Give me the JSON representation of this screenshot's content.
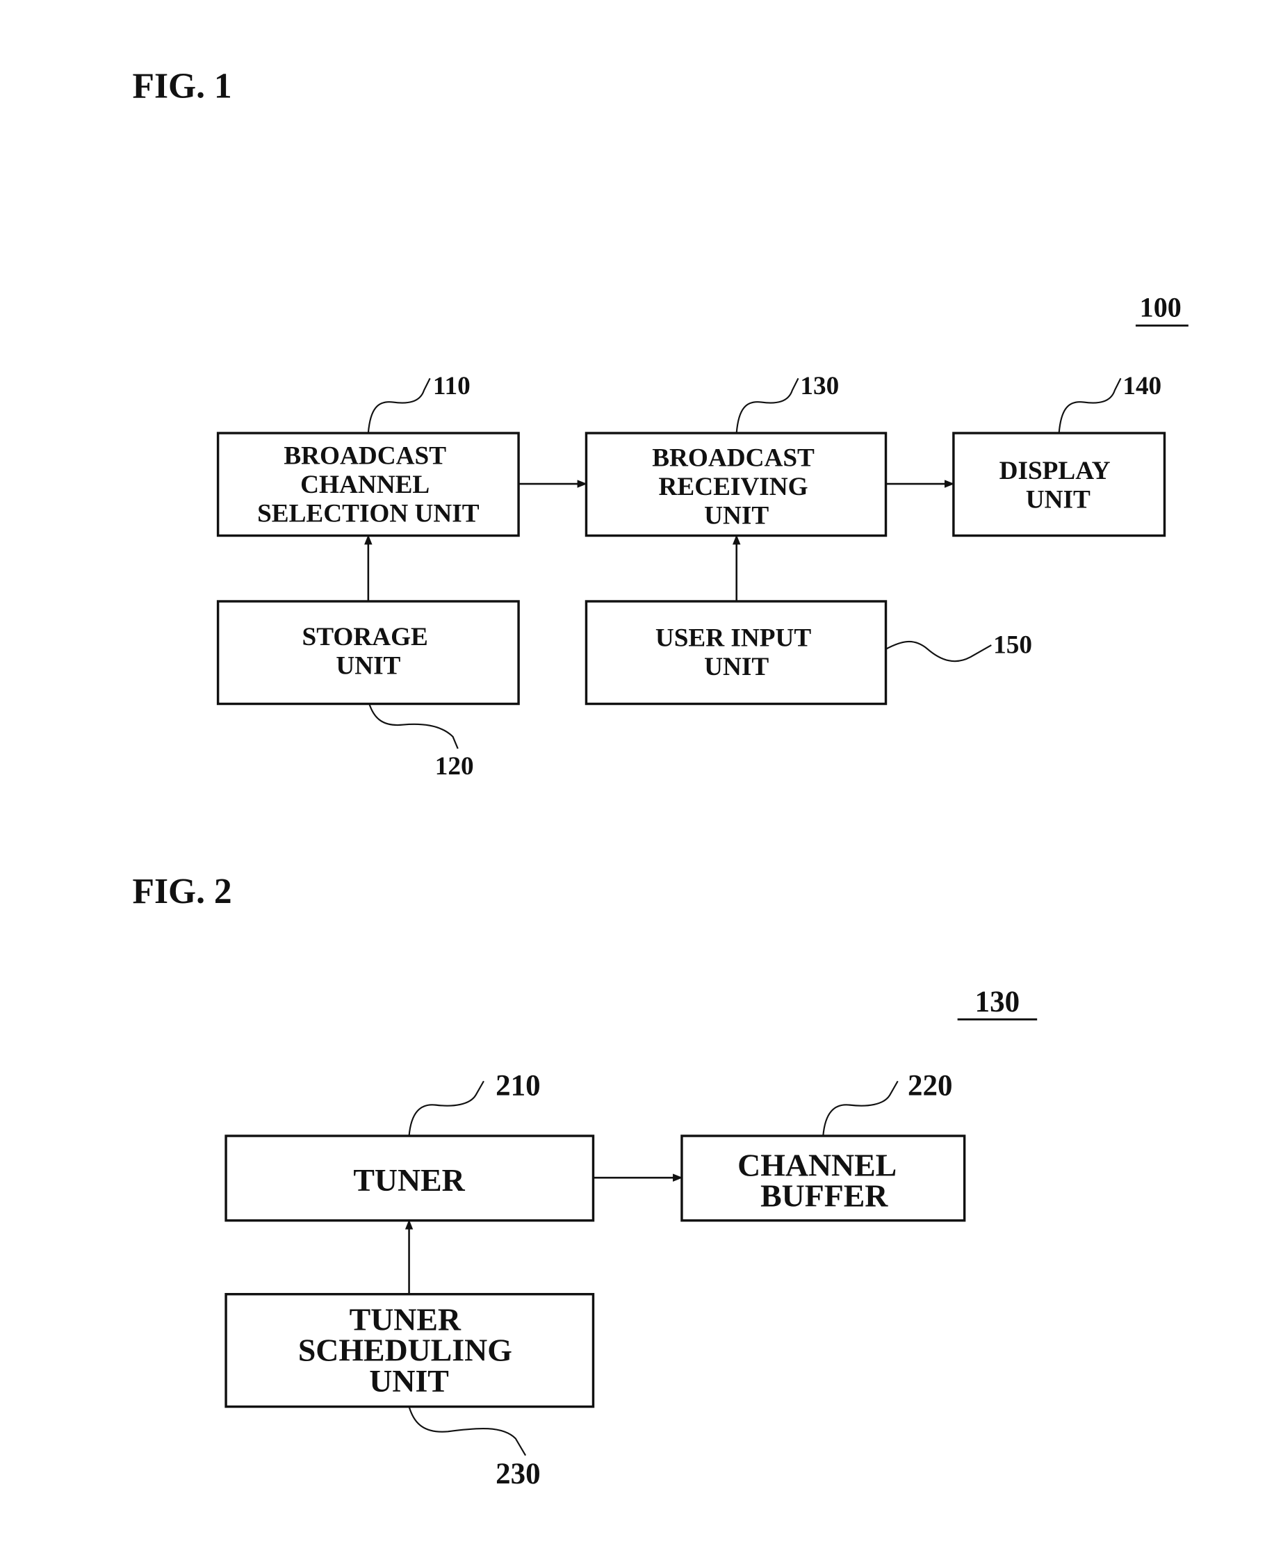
{
  "figures": [
    {
      "title": "FIG. 1",
      "system_ref": "100",
      "blocks": [
        {
          "id": "110",
          "lines": [
            "BROADCAST",
            "CHANNEL",
            "SELECTION UNIT"
          ]
        },
        {
          "id": "130",
          "lines": [
            "BROADCAST",
            "RECEIVING",
            "UNIT"
          ]
        },
        {
          "id": "140",
          "lines": [
            "DISPLAY",
            "UNIT"
          ]
        },
        {
          "id": "120",
          "lines": [
            "STORAGE",
            "UNIT"
          ]
        },
        {
          "id": "150",
          "lines": [
            "USER INPUT",
            "UNIT"
          ]
        }
      ],
      "connections": [
        {
          "from": "110",
          "to": "130"
        },
        {
          "from": "130",
          "to": "140"
        },
        {
          "from": "120",
          "to": "110"
        },
        {
          "from": "150",
          "to": "130"
        }
      ]
    },
    {
      "title": "FIG. 2",
      "system_ref": "130",
      "blocks": [
        {
          "id": "210",
          "lines": [
            "TUNER"
          ]
        },
        {
          "id": "220",
          "lines": [
            "CHANNEL",
            "BUFFER"
          ]
        },
        {
          "id": "230",
          "lines": [
            "TUNER",
            "SCHEDULING",
            "UNIT"
          ]
        }
      ],
      "connections": [
        {
          "from": "210",
          "to": "220"
        },
        {
          "from": "230",
          "to": "210"
        }
      ]
    }
  ]
}
